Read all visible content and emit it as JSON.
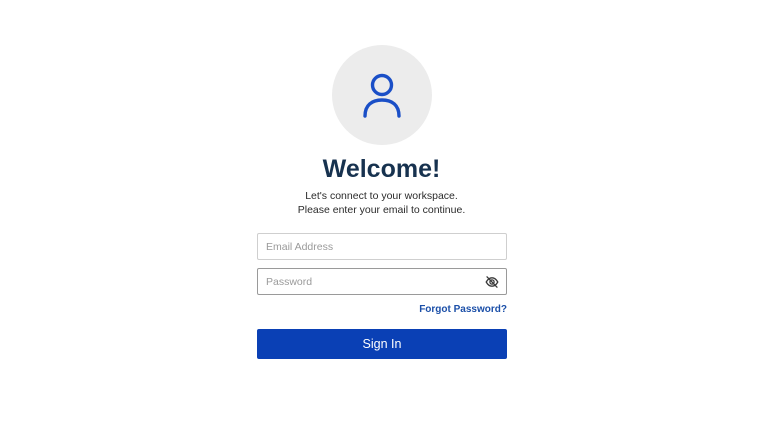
{
  "header": {
    "avatar_icon": "user-icon",
    "title": "Welcome!",
    "subtitle_line1": "Let's connect to your workspace.",
    "subtitle_line2": "Please enter your email to continue."
  },
  "form": {
    "email": {
      "placeholder": "Email Address",
      "value": ""
    },
    "password": {
      "placeholder": "Password",
      "value": "",
      "toggle_icon": "eye-slash-icon"
    },
    "forgot_password_label": "Forgot Password?",
    "submit_label": "Sign In"
  },
  "colors": {
    "primary": "#0a40b5",
    "title": "#17324f",
    "link": "#1b4fa8",
    "avatar_bg": "#ececec",
    "icon": "#1a4fc7"
  }
}
